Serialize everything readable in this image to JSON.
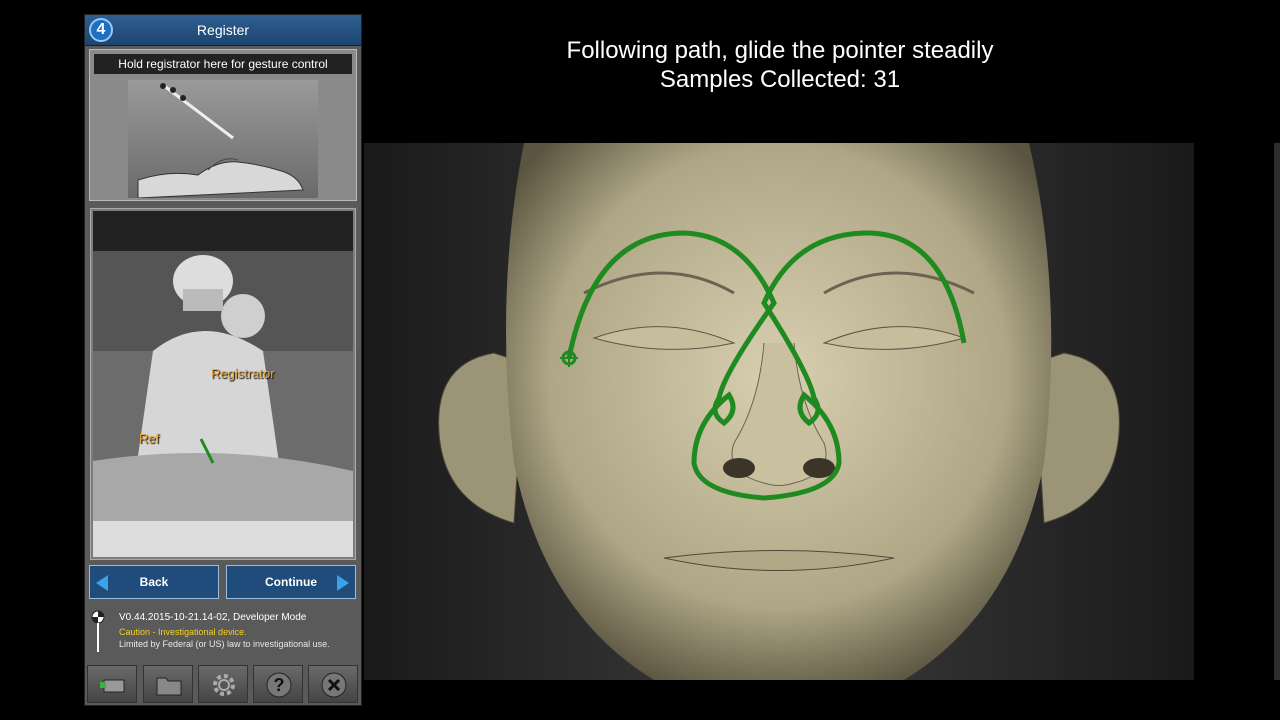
{
  "panel": {
    "step_number": "4",
    "title": "Register",
    "gesture_label": "Hold registrator here for gesture control",
    "camera_labels": {
      "registrator": "Registrator",
      "ref": "Ref"
    },
    "back_label": "Back",
    "continue_label": "Continue",
    "version": "V0.44.2015-10-21.14-02, Developer Mode",
    "caution": "Caution - Investigational device.",
    "limited": "Limited by Federal (or US) law to investigational use."
  },
  "toolbar": {
    "items": [
      "load-icon",
      "folder-icon",
      "gear-icon",
      "help-icon",
      "close-icon"
    ]
  },
  "main": {
    "instruction": "Following path, glide the pointer steadily",
    "samples_text": "Samples Collected: 31"
  },
  "colors": {
    "header_blue": "#2f5f92",
    "button_blue": "#1f4c7a",
    "path_green": "#1f8a1f",
    "caution_yellow": "#f5d020",
    "label_orange": "#e8a735"
  }
}
